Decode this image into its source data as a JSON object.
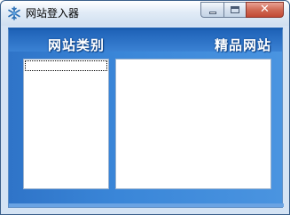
{
  "window": {
    "title": "网站登入器",
    "icon": "snowflake-icon"
  },
  "caption_buttons": {
    "close_glyph": "✕"
  },
  "panel": {
    "left_header": "网站类别",
    "right_header": "精品网站"
  },
  "lists": {
    "category_items": [],
    "site_items": []
  },
  "colors": {
    "panel_blue": "#3a86d8",
    "header_text": "#ffffff"
  }
}
